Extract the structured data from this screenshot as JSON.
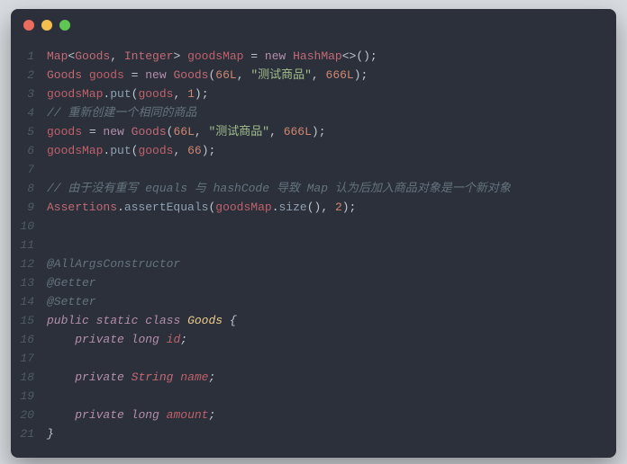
{
  "window": {
    "title": ""
  },
  "code": {
    "lines": [
      {
        "n": "1",
        "tokens": [
          [
            "tk-type",
            "Map"
          ],
          [
            "tk-punct",
            "<"
          ],
          [
            "tk-type",
            "Goods"
          ],
          [
            "tk-punct",
            ", "
          ],
          [
            "tk-type",
            "Integer"
          ],
          [
            "tk-punct",
            "> "
          ],
          [
            "tk-var",
            "goodsMap"
          ],
          [
            "tk-op",
            " = "
          ],
          [
            "tk-key",
            "new"
          ],
          [
            "tk-punct",
            " "
          ],
          [
            "tk-type",
            "HashMap"
          ],
          [
            "tk-punct",
            "<>();"
          ]
        ]
      },
      {
        "n": "2",
        "tokens": [
          [
            "tk-type",
            "Goods"
          ],
          [
            "tk-punct",
            " "
          ],
          [
            "tk-var",
            "goods"
          ],
          [
            "tk-op",
            " = "
          ],
          [
            "tk-key",
            "new"
          ],
          [
            "tk-punct",
            " "
          ],
          [
            "tk-type",
            "Goods"
          ],
          [
            "tk-punct",
            "("
          ],
          [
            "tk-num",
            "66L"
          ],
          [
            "tk-punct",
            ", "
          ],
          [
            "tk-str",
            "\"测试商品\""
          ],
          [
            "tk-punct",
            ", "
          ],
          [
            "tk-num",
            "666L"
          ],
          [
            "tk-punct",
            ");"
          ]
        ]
      },
      {
        "n": "3",
        "tokens": [
          [
            "tk-var",
            "goodsMap"
          ],
          [
            "tk-punct",
            "."
          ],
          [
            "tk-method",
            "put"
          ],
          [
            "tk-punct",
            "("
          ],
          [
            "tk-var",
            "goods"
          ],
          [
            "tk-punct",
            ", "
          ],
          [
            "tk-num",
            "1"
          ],
          [
            "tk-punct",
            ");"
          ]
        ]
      },
      {
        "n": "4",
        "tokens": [
          [
            "tk-comment",
            "// 重新创建一个相同的商品"
          ]
        ]
      },
      {
        "n": "5",
        "tokens": [
          [
            "tk-var",
            "goods"
          ],
          [
            "tk-op",
            " = "
          ],
          [
            "tk-key",
            "new"
          ],
          [
            "tk-punct",
            " "
          ],
          [
            "tk-type",
            "Goods"
          ],
          [
            "tk-punct",
            "("
          ],
          [
            "tk-num",
            "66L"
          ],
          [
            "tk-punct",
            ", "
          ],
          [
            "tk-str",
            "\"测试商品\""
          ],
          [
            "tk-punct",
            ", "
          ],
          [
            "tk-num",
            "666L"
          ],
          [
            "tk-punct",
            ");"
          ]
        ]
      },
      {
        "n": "6",
        "tokens": [
          [
            "tk-var",
            "goodsMap"
          ],
          [
            "tk-punct",
            "."
          ],
          [
            "tk-method",
            "put"
          ],
          [
            "tk-punct",
            "("
          ],
          [
            "tk-var",
            "goods"
          ],
          [
            "tk-punct",
            ", "
          ],
          [
            "tk-num",
            "66"
          ],
          [
            "tk-punct",
            ");"
          ]
        ]
      },
      {
        "n": "7",
        "tokens": []
      },
      {
        "n": "8",
        "tokens": [
          [
            "tk-comment",
            "// 由于没有重写 equals 与 hashCode 导致 Map 认为后加入商品对象是一个新对象"
          ]
        ]
      },
      {
        "n": "9",
        "tokens": [
          [
            "tk-type",
            "Assertions"
          ],
          [
            "tk-punct",
            "."
          ],
          [
            "tk-method",
            "assertEquals"
          ],
          [
            "tk-punct",
            "("
          ],
          [
            "tk-var",
            "goodsMap"
          ],
          [
            "tk-punct",
            "."
          ],
          [
            "tk-method",
            "size"
          ],
          [
            "tk-punct",
            "(), "
          ],
          [
            "tk-num",
            "2"
          ],
          [
            "tk-punct",
            ");"
          ]
        ]
      },
      {
        "n": "10",
        "tokens": []
      },
      {
        "n": "11",
        "tokens": []
      },
      {
        "n": "12",
        "tokens": [
          [
            "tk-ann",
            "@AllArgsConstructor"
          ]
        ]
      },
      {
        "n": "13",
        "tokens": [
          [
            "tk-ann",
            "@Getter"
          ]
        ]
      },
      {
        "n": "14",
        "tokens": [
          [
            "tk-ann",
            "@Setter"
          ]
        ]
      },
      {
        "n": "15",
        "tokens": [
          [
            "tk-key italic",
            "public"
          ],
          [
            "tk-punct",
            " "
          ],
          [
            "tk-key italic",
            "static"
          ],
          [
            "tk-punct",
            " "
          ],
          [
            "tk-key italic",
            "class"
          ],
          [
            "tk-punct",
            " "
          ],
          [
            "tk-class italic",
            "Goods"
          ],
          [
            "tk-punct italic",
            " {"
          ]
        ]
      },
      {
        "n": "16",
        "tokens": [
          [
            "tk-punct",
            "    "
          ],
          [
            "tk-key italic",
            "private"
          ],
          [
            "tk-punct",
            " "
          ],
          [
            "tk-key italic",
            "long"
          ],
          [
            "tk-punct",
            " "
          ],
          [
            "tk-field",
            "id"
          ],
          [
            "tk-punct italic",
            ";"
          ]
        ]
      },
      {
        "n": "17",
        "tokens": []
      },
      {
        "n": "18",
        "tokens": [
          [
            "tk-punct",
            "    "
          ],
          [
            "tk-key italic",
            "private"
          ],
          [
            "tk-punct",
            " "
          ],
          [
            "tk-type italic",
            "String"
          ],
          [
            "tk-punct",
            " "
          ],
          [
            "tk-field",
            "name"
          ],
          [
            "tk-punct italic",
            ";"
          ]
        ]
      },
      {
        "n": "19",
        "tokens": []
      },
      {
        "n": "20",
        "tokens": [
          [
            "tk-punct",
            "    "
          ],
          [
            "tk-key italic",
            "private"
          ],
          [
            "tk-punct",
            " "
          ],
          [
            "tk-key italic",
            "long"
          ],
          [
            "tk-punct",
            " "
          ],
          [
            "tk-field",
            "amount"
          ],
          [
            "tk-punct italic",
            ";"
          ]
        ]
      },
      {
        "n": "21",
        "tokens": [
          [
            "tk-punct italic",
            "}"
          ]
        ]
      }
    ]
  }
}
